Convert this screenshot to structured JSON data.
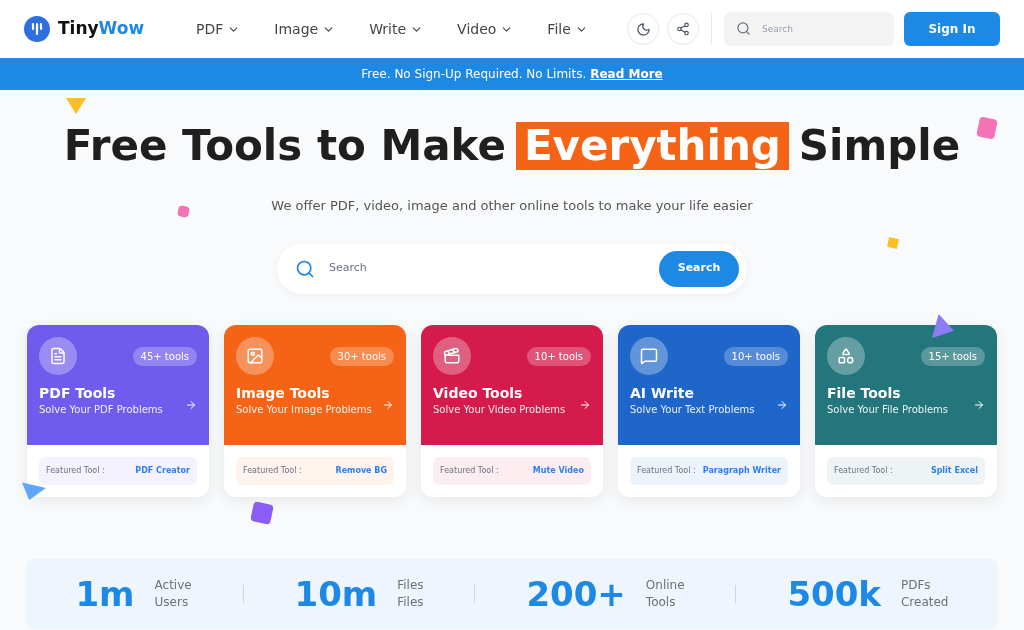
{
  "header": {
    "logo_prefix": "Tiny",
    "logo_suffix": "Wow",
    "menu": [
      "PDF",
      "Image",
      "Write",
      "Video",
      "File"
    ],
    "search": {
      "placeholder": "Search"
    },
    "sign_in": "Sign In"
  },
  "banner": {
    "text": "Free. No Sign-Up Required. No Limits.",
    "link": "Read More"
  },
  "hero": {
    "headline_before": "Free Tools to Make",
    "headline_highlight": "Everything",
    "headline_after": "Simple",
    "subtitle": "We offer PDF, video, image and other online tools to make your life easier",
    "search": {
      "placeholder": "Search",
      "button": "Search"
    }
  },
  "cards": [
    {
      "kind": "pdf",
      "color": "#6f5bec",
      "count": "45+ tools",
      "title": "PDF Tools",
      "subtitle": "Solve Your PDF Problems",
      "featured_label": "Featured Tool :",
      "featured_tool": "PDF Creator"
    },
    {
      "kind": "image",
      "color": "#f56416",
      "count": "30+ tools",
      "title": "Image Tools",
      "subtitle": "Solve Your Image Problems",
      "featured_label": "Featured Tool :",
      "featured_tool": "Remove BG"
    },
    {
      "kind": "video",
      "color": "#d41b4b",
      "count": "10+ tools",
      "title": "Video Tools",
      "subtitle": "Solve Your Video Problems",
      "featured_label": "Featured Tool :",
      "featured_tool": "Mute Video"
    },
    {
      "kind": "write",
      "color": "#1e66c9",
      "count": "10+ tools",
      "title": "AI Write",
      "subtitle": "Solve Your Text Problems",
      "featured_label": "Featured Tool :",
      "featured_tool": "Paragraph Writer"
    },
    {
      "kind": "file",
      "color": "#23767c",
      "count": "15+ tools",
      "title": "File Tools",
      "subtitle": "Solve Your File Problems",
      "featured_label": "Featured Tool :",
      "featured_tool": "Split Excel"
    }
  ],
  "stats": [
    {
      "value": "1m",
      "line1": "Active",
      "line2": "Users"
    },
    {
      "value": "10m",
      "line1": "Files",
      "line2": "Files"
    },
    {
      "value": "200+",
      "line1": "Online",
      "line2": "Tools"
    },
    {
      "value": "500k",
      "line1": "PDFs",
      "line2": "Created"
    }
  ]
}
